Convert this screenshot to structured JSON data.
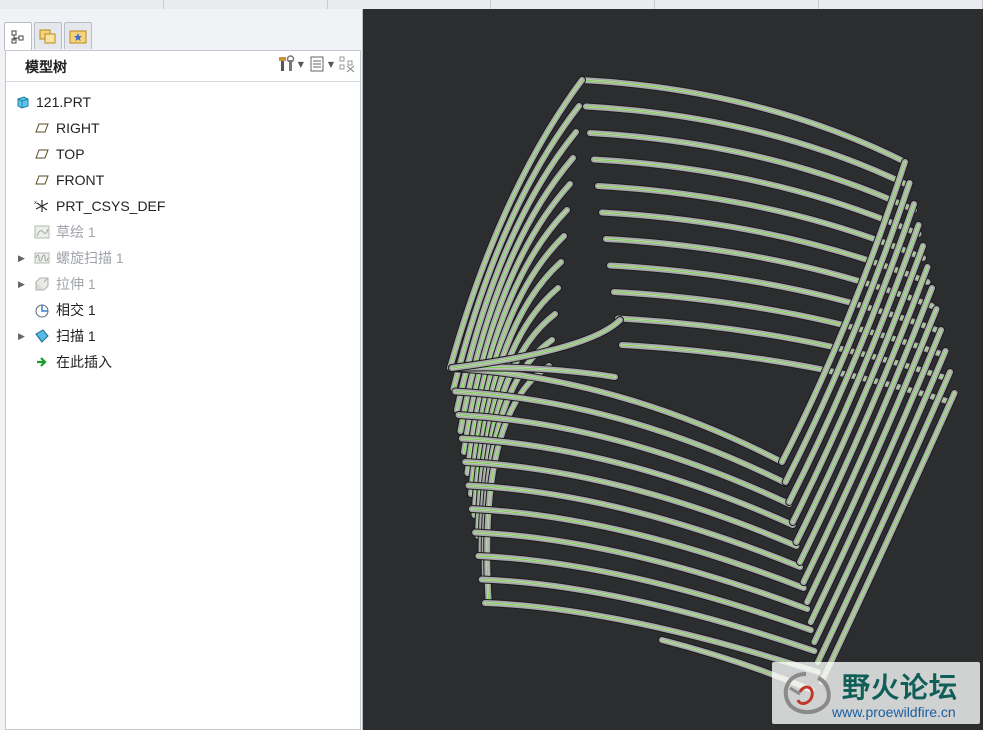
{
  "panel": {
    "title": "模型树"
  },
  "tree": {
    "items": [
      {
        "label": "121.PRT",
        "icon": "part-icon",
        "expander": false,
        "dim": false
      },
      {
        "label": "RIGHT",
        "icon": "datum-plane-icon",
        "expander": false,
        "dim": false
      },
      {
        "label": "TOP",
        "icon": "datum-plane-icon",
        "expander": false,
        "dim": false
      },
      {
        "label": "FRONT",
        "icon": "datum-plane-icon",
        "expander": false,
        "dim": false
      },
      {
        "label": "PRT_CSYS_DEF",
        "icon": "coordinate-system-icon",
        "expander": false,
        "dim": false
      },
      {
        "label": "草绘 1",
        "icon": "sketch-icon",
        "expander": false,
        "dim": true
      },
      {
        "label": "螺旋扫描 1",
        "icon": "helical-sweep-icon",
        "expander": true,
        "dim": true
      },
      {
        "label": "拉伸 1",
        "icon": "extrude-icon",
        "expander": true,
        "dim": true
      },
      {
        "label": "相交 1",
        "icon": "intersect-icon",
        "expander": false,
        "dim": false
      },
      {
        "label": "扫描 1",
        "icon": "sweep-icon",
        "expander": true,
        "dim": false
      },
      {
        "label": "在此插入",
        "icon": "insert-here-arrow-icon",
        "expander": false,
        "dim": false
      }
    ]
  },
  "watermark": {
    "title": "野火论坛",
    "url": "www.proewildfire.cn"
  },
  "colors": {
    "viewport_bg": "#2b2d2f",
    "tube": "#a7aaa6",
    "edge_green": "#6fd33d"
  }
}
